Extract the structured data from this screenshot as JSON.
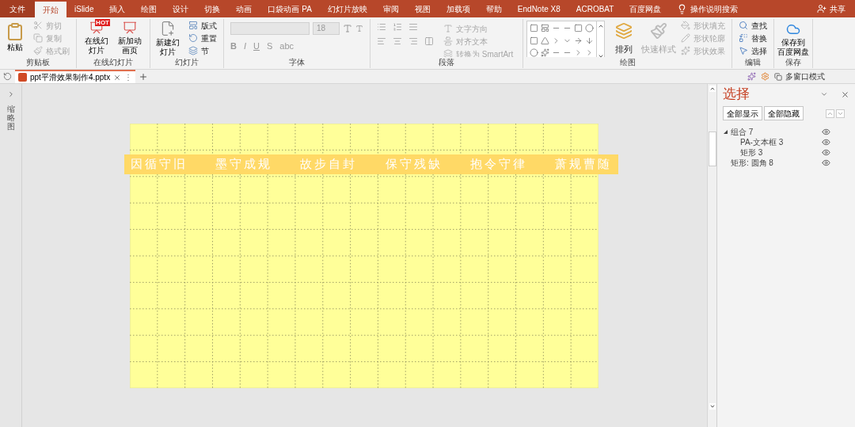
{
  "menu_tabs": [
    {
      "label": "文件",
      "kind": "file",
      "selected": false
    },
    {
      "label": "开始",
      "kind": "tab",
      "selected": true
    },
    {
      "label": "iSlide",
      "kind": "tab",
      "selected": false
    },
    {
      "label": "插入",
      "kind": "tab",
      "selected": false
    },
    {
      "label": "绘图",
      "kind": "tab",
      "selected": false
    },
    {
      "label": "设计",
      "kind": "tab",
      "selected": false
    },
    {
      "label": "切换",
      "kind": "tab",
      "selected": false
    },
    {
      "label": "动画",
      "kind": "tab",
      "selected": false
    },
    {
      "label": "口袋动画 PA",
      "kind": "tab",
      "selected": false
    },
    {
      "label": "幻灯片放映",
      "kind": "tab",
      "selected": false
    },
    {
      "label": "审阅",
      "kind": "tab",
      "selected": false
    },
    {
      "label": "视图",
      "kind": "tab",
      "selected": false
    },
    {
      "label": "加载项",
      "kind": "tab",
      "selected": false
    },
    {
      "label": "帮助",
      "kind": "tab",
      "selected": false
    },
    {
      "label": "EndNote X8",
      "kind": "tab",
      "selected": false
    },
    {
      "label": "ACROBAT",
      "kind": "tab",
      "selected": false
    },
    {
      "label": "百度网盘",
      "kind": "tab",
      "selected": false
    }
  ],
  "tell_me": "操作说明搜索",
  "share": "共享",
  "ribbon": [
    {
      "label": "剪贴板",
      "kind": "clipboard",
      "large": [
        {
          "label": "粘贴"
        }
      ],
      "small": [
        {
          "label": "剪切",
          "disabled": true
        },
        {
          "label": "复制",
          "disabled": true
        },
        {
          "label": "格式刷",
          "disabled": true
        }
      ]
    },
    {
      "label": "在线幻灯片",
      "kind": "online",
      "large": [
        {
          "label": "在线幻灯片"
        },
        {
          "label": "新加动画页"
        }
      ],
      "badge": "HOT"
    },
    {
      "label": "幻灯片",
      "kind": "slides",
      "large": [
        {
          "label": "新建幻灯片"
        }
      ],
      "small": [
        {
          "label": "版式",
          "disabled": false
        },
        {
          "label": "重置",
          "disabled": false
        },
        {
          "label": "节",
          "disabled": false
        }
      ]
    },
    {
      "label": "字体",
      "kind": "font",
      "size": "18",
      "tools": [
        "B",
        "I",
        "U",
        "S",
        "abc"
      ]
    },
    {
      "label": "段落",
      "kind": "paragraph",
      "small": [
        {
          "label": "文字方向",
          "disabled": true
        },
        {
          "label": "对齐文本",
          "disabled": true
        },
        {
          "label": "转换为 SmartArt",
          "disabled": true
        }
      ]
    },
    {
      "label": "绘图",
      "kind": "drawing",
      "large": [
        {
          "label": "排列",
          "disabled": false
        },
        {
          "label": "快速样式",
          "disabled": true
        }
      ],
      "small": [
        {
          "label": "形状填充",
          "disabled": true
        },
        {
          "label": "形状轮廓",
          "disabled": true
        },
        {
          "label": "形状效果",
          "disabled": true
        }
      ]
    },
    {
      "label": "编辑",
      "kind": "editing",
      "small": [
        {
          "label": "查找",
          "disabled": false
        },
        {
          "label": "替换",
          "disabled": false
        },
        {
          "label": "选择",
          "disabled": false
        }
      ]
    },
    {
      "label": "保存",
      "kind": "save",
      "large": [
        {
          "label": "保存到"
        },
        {
          "label": "百度网盘"
        }
      ]
    }
  ],
  "document_tab": {
    "title": "ppt平滑效果制作4.pptx",
    "more": "⋮"
  },
  "multi_window": "多窗口模式",
  "thumbnail_pane": "缩略图",
  "slide": {
    "phrases": [
      "因循守旧",
      "墨守成规",
      "故步自封",
      "保守残缺",
      "抱令守律",
      "萧规曹随"
    ]
  },
  "selection_pane": {
    "title": "选择",
    "show_all": "全部显示",
    "hide_all": "全部隐藏",
    "items": [
      {
        "name": "组合 7",
        "expanded": true,
        "visible": true,
        "children": [
          {
            "name": "PA-文本框 3",
            "visible": true
          },
          {
            "name": "矩形 3",
            "visible": true
          }
        ]
      },
      {
        "name": "矩形: 圆角 8",
        "visible": true
      }
    ]
  }
}
